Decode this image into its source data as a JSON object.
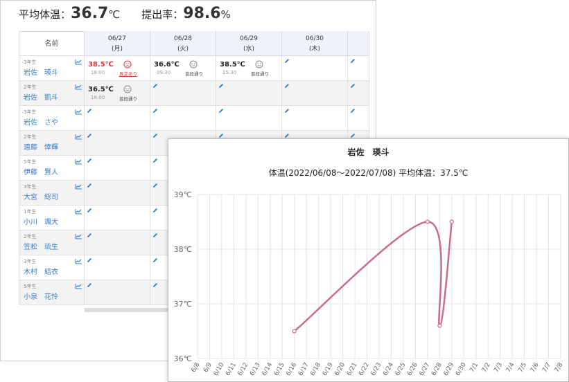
{
  "summary": {
    "avg_label": "平均体温：",
    "avg_value": "36.7",
    "avg_unit": "℃",
    "rate_label": "提出率：",
    "rate_value": "98.6",
    "rate_unit": "%"
  },
  "table": {
    "name_header": "名前",
    "dates": [
      {
        "date": "06/27",
        "weekday": "(月)"
      },
      {
        "date": "06/28",
        "weekday": "(火)"
      },
      {
        "date": "06/29",
        "weekday": "(水)"
      },
      {
        "date": "06/30",
        "weekday": "(木)"
      }
    ],
    "students": [
      {
        "grade": "3年生",
        "name": "岩佐　瑛斗"
      },
      {
        "grade": "2年生",
        "name": "岩佐　凱斗"
      },
      {
        "grade": "3年生",
        "name": "岩佐　さや"
      },
      {
        "grade": "2年生",
        "name": "遠藤　倖輝"
      },
      {
        "grade": "5年生",
        "name": "伊藤　賢人"
      },
      {
        "grade": "3年生",
        "name": "大宮　総司"
      },
      {
        "grade": "1年生",
        "name": "小川　颯大"
      },
      {
        "grade": "2年生",
        "name": "笠松　琉生"
      },
      {
        "grade": "3年生",
        "name": "木村　結衣"
      },
      {
        "grade": "5年生",
        "name": "小泉　花怜"
      }
    ],
    "records": [
      [
        {
          "temp": "38.5℃",
          "time": "18:00",
          "mood": "異変あり",
          "hot": true
        },
        {
          "temp": "36.6℃",
          "time": "09:30",
          "mood": "普段通り",
          "hot": false
        },
        {
          "temp": "38.5℃",
          "time": "15:30",
          "mood": "普段通り",
          "hot": false
        }
      ],
      [
        {
          "temp": "36.5℃",
          "time": "18:00",
          "mood": "普段通り",
          "hot": false
        }
      ]
    ]
  },
  "icons": {
    "trend": "trend-chart-icon",
    "edit": "pencil-icon",
    "mood_good": "smile-face-icon",
    "mood_bad": "sad-face-icon"
  },
  "colors": {
    "link": "#3a7cc4",
    "hot": "#e0393e",
    "series": "#c96a8f",
    "header_bg": "#eef2fb"
  },
  "popup": {
    "student_name": "岩佐　瑛斗",
    "subtitle": "体温(2022/06/08～2022/07/08) 平均体温：37.5℃"
  },
  "chart_data": {
    "type": "line",
    "title": "体温(2022/06/08～2022/07/08) 平均体温：37.5℃",
    "categories": [
      "6/8",
      "6/9",
      "6/10",
      "6/11",
      "6/12",
      "6/13",
      "6/14",
      "6/15",
      "6/16",
      "6/17",
      "6/18",
      "6/19",
      "6/20",
      "6/21",
      "6/22",
      "6/23",
      "6/24",
      "6/25",
      "6/26",
      "6/27",
      "6/28",
      "6/29",
      "6/30",
      "7/1",
      "7/2",
      "7/3",
      "7/4",
      "7/5",
      "7/6",
      "7/7",
      "7/8"
    ],
    "x": [
      "6/16",
      "6/27",
      "6/28",
      "6/29"
    ],
    "values": [
      36.5,
      38.5,
      36.6,
      38.5
    ],
    "yticks": [
      "36℃",
      "37℃",
      "38℃",
      "39℃"
    ],
    "ylim": [
      36,
      39
    ],
    "grid": true,
    "smooth": true
  }
}
